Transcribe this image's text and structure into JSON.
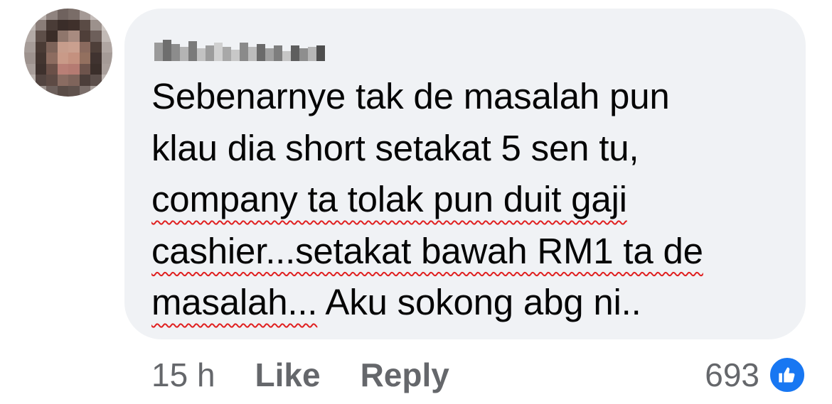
{
  "comment": {
    "author_name_blurred": true,
    "avatar_blurred": true,
    "body_lines": [
      "Sebenarnye tak de masalah pun",
      "klau dia short setakat 5 sen tu,",
      "company ta tolak pun duit gaji",
      "cashier...setakat bawah RM1 ta de",
      "masalah... Aku sokong abg ni.."
    ],
    "underlined": {
      "line3": "company ta tolak pun duit gaji",
      "line4": "cashier...setakat bawah RM1 ta de",
      "line5_part": "masalah...",
      "line5_rest": " Aku sokong abg ni.."
    }
  },
  "actions": {
    "time": "15 h",
    "like_label": "Like",
    "reply_label": "Reply"
  },
  "reactions": {
    "count": "693",
    "icon": "thumbs-up-icon",
    "badge_color": "#1877f2"
  },
  "colors": {
    "bubble_bg": "#f0f2f5",
    "text": "#050505",
    "secondary": "#65676b",
    "spellcheck": "#e02020"
  }
}
